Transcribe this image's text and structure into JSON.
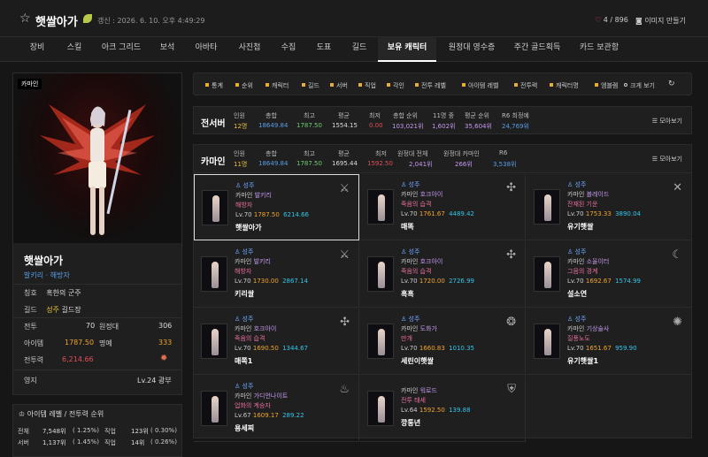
{
  "header": {
    "char_name": "햇쌀아가",
    "updated": "갱신 : 2026. 6. 10. 오후 4:49:29",
    "likes": "4 / 896",
    "image_label": "이미지 만들기"
  },
  "tabs": [
    "장비",
    "스킬",
    "아크 그리드",
    "보석",
    "아바타",
    "사진첩",
    "수집",
    "도표",
    "길드",
    "보유 캐릭터",
    "원정대 영수증",
    "주간 골드획득",
    "카드 보관함"
  ],
  "active_tab": "보유 캐릭터",
  "profile": {
    "server_tag": "카마인",
    "name": "햇쌀아가",
    "class": "발키리",
    "sub": "해방자",
    "title_label": "칭호",
    "title": "혹한의 군주",
    "guild_label": "길드",
    "guild_server": "성주",
    "guild_role": "길드장",
    "pvp_label": "전투",
    "pvp": "70",
    "expedition_label": "원정대",
    "expedition": "306",
    "ilvl_label": "아이템",
    "ilvl": "1787.50",
    "honor_label": "명예",
    "honor": "333",
    "power_label": "전투력",
    "power": "6,214.66",
    "estate_label": "영지",
    "estate": "Lv.24 광부"
  },
  "ranking": {
    "title": "아이템 레벨 / 전투력 순위",
    "rows": [
      {
        "label": "전체",
        "rank": "7,548위",
        "pct": "( 1.25%)",
        "cls_label": "직업",
        "cls_rank": "123위",
        "cls_pct": "( 0.30%)"
      },
      {
        "label": "서버",
        "rank": "1,137위",
        "pct": "( 1.45%)",
        "cls_label": "직업",
        "cls_rank": "14위",
        "cls_pct": "( 0.26%)"
      }
    ]
  },
  "filters": [
    "통계",
    "순위",
    "캐릭터",
    "길드",
    "서버",
    "직업",
    "각인",
    "전투 레벨",
    "아이템 레벨",
    "전투력",
    "캐릭터명",
    "엠블렘",
    "크게 보기"
  ],
  "all_server": {
    "label": "전서버",
    "headers": [
      "인원",
      "총합",
      "최고",
      "평균",
      "최저",
      "총합 순위",
      "11명 중",
      "평균 순위",
      "R6 최정예"
    ],
    "values": [
      "12명",
      "18649.84",
      "1787.50",
      "1554.15",
      "0.00",
      "103,021위",
      "1,602위",
      "35,604위",
      "24,769위"
    ],
    "more": "모아보기"
  },
  "kamine": {
    "label": "카마인",
    "headers": [
      "인원",
      "총합",
      "최고",
      "평균",
      "최저",
      "원정대 전체",
      "원정대 카마인",
      "R6"
    ],
    "values": [
      "11명",
      "18649.84",
      "1787.50",
      "1695.44",
      "1592.50",
      "2,041위",
      "266위",
      "3,538위"
    ],
    "more": "모아보기"
  },
  "characters": [
    {
      "guild": "성주",
      "server": "카마인",
      "cls": "발키리",
      "sub": "해방자",
      "lv": "Lv.70",
      "ilvl": "1787.50",
      "cp": "6214.66",
      "name": "햇쌀아가",
      "icon": "valkyrie-emblem-icon"
    },
    {
      "guild": "성주",
      "server": "카마인",
      "cls": "호크아이",
      "sub": "죽음의 습격",
      "lv": "Lv.70",
      "ilvl": "1761.67",
      "cp": "4489.42",
      "name": "매똑",
      "icon": "hawkeye-emblem-icon"
    },
    {
      "guild": "성주",
      "server": "카마인",
      "cls": "블레이드",
      "sub": "잔재된 기운",
      "lv": "Lv.70",
      "ilvl": "1753.33",
      "cp": "3890.04",
      "name": "유기햇쌀",
      "icon": "blade-emblem-icon"
    },
    {
      "guild": "성주",
      "server": "카마인",
      "cls": "발키리",
      "sub": "해방자",
      "lv": "Lv.70",
      "ilvl": "1730.00",
      "cp": "2867.14",
      "name": "키리쌀",
      "icon": "valkyrie-emblem-icon"
    },
    {
      "guild": "성주",
      "server": "카마인",
      "cls": "호크아이",
      "sub": "죽음의 습격",
      "lv": "Lv.70",
      "ilvl": "1720.00",
      "cp": "2726.99",
      "name": "흑흑",
      "icon": "hawkeye-emblem-icon"
    },
    {
      "guild": "성주",
      "server": "카마인",
      "cls": "소울이터",
      "sub": "그믐의 경계",
      "lv": "Lv.70",
      "ilvl": "1692.67",
      "cp": "1574.99",
      "name": "설소연",
      "icon": "souleater-emblem-icon"
    },
    {
      "guild": "성주",
      "server": "카마인",
      "cls": "호크아이",
      "sub": "죽음의 습격",
      "lv": "Lv.70",
      "ilvl": "1690.50",
      "cp": "1344.67",
      "name": "매쪽1",
      "icon": "hawkeye-emblem-icon"
    },
    {
      "guild": "성주",
      "server": "카마인",
      "cls": "도화가",
      "sub": "만개",
      "lv": "Lv.70",
      "ilvl": "1660.83",
      "cp": "1010.35",
      "name": "세린이햇쌀",
      "icon": "artist-emblem-icon"
    },
    {
      "guild": "성주",
      "server": "카마인",
      "cls": "기상술사",
      "sub": "질풍노도",
      "lv": "Lv.70",
      "ilvl": "1651.67",
      "cp": "959.90",
      "name": "유기햇쌀1",
      "icon": "aeromancer-emblem-icon"
    },
    {
      "guild": "성주",
      "server": "카마인",
      "cls": "가디언나이트",
      "sub": "업화의 계승자",
      "lv": "Lv.67",
      "ilvl": "1609.17",
      "cp": "289.22",
      "name": "용세찌",
      "icon": "guardian-knight-emblem-icon"
    },
    {
      "guild": "",
      "server": "카마인",
      "cls": "워로드",
      "sub": "전투 태세",
      "lv": "Lv.64",
      "ilvl": "1592.50",
      "cp": "139.88",
      "name": "깡통년",
      "icon": "warlord-emblem-icon"
    }
  ],
  "colors": {
    "guild": "#6fa8ff",
    "server": "#cccccc",
    "cls": "#c59af0",
    "ilvl": "#f0a52a",
    "cp": "#33c6e8",
    "orange": "#f0a52a",
    "red": "#e0505a",
    "yellow": "#e4c43a",
    "green": "#6fcf6f",
    "blue": "#5a9ee8"
  }
}
